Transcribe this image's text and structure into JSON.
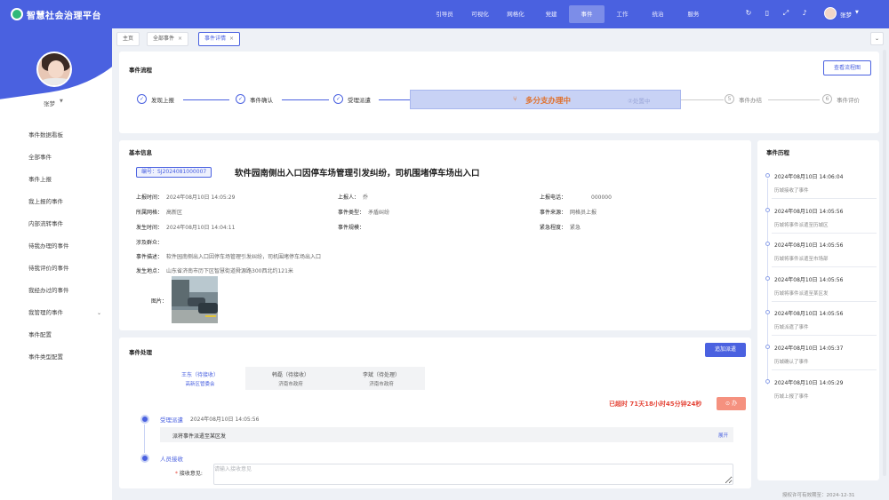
{
  "app": {
    "title": "智慧社会治理平台"
  },
  "nav": [
    "引导员",
    "可视化",
    "网格化",
    "党建",
    "事件",
    "工作",
    "统治",
    "服务"
  ],
  "nav_active_index": 4,
  "header": {
    "user": "张梦",
    "icons": [
      "refresh-icon",
      "mobile-icon",
      "fullscreen-icon",
      "bell-icon"
    ]
  },
  "sidebar": {
    "user": "张梦",
    "items": [
      "事件数据看板",
      "全部事件",
      "事件上报",
      "我上报的事件",
      "内部流转事件",
      "待我办理的事件",
      "待我评价的事件",
      "我经办过的事件",
      "我管理的事件",
      "事件配置",
      "事件类型配置"
    ]
  },
  "tabs": [
    {
      "label": "主页",
      "closable": false
    },
    {
      "label": "全部事件",
      "closable": true
    },
    {
      "label": "事件详情",
      "closable": true
    }
  ],
  "flow": {
    "title": "事件流程",
    "button": "查看流程图",
    "steps": [
      {
        "label": "发现上报",
        "state": "done"
      },
      {
        "label": "事件确认",
        "state": "done"
      },
      {
        "label": "受理派遣",
        "state": "done"
      },
      {
        "label": "事件办结",
        "state": "todo",
        "num": "5"
      },
      {
        "label": "事件评价",
        "state": "todo",
        "num": "6"
      }
    ],
    "current": {
      "label": "多分支办理中",
      "ghost": "②处置中"
    }
  },
  "basic": {
    "title": "基本信息",
    "code": "编号：SJ2024081000007",
    "event_title": "软件园南侧出入口因停车场管理引发纠纷，司机围堵停车场出入口",
    "fields": {
      "report_time_k": "上报时间：",
      "report_time_v": "2024年08月10日 14:05:29",
      "reporter_k": "上报人：",
      "reporter_v": "乔",
      "reporter_phone_k": "上报电话：",
      "reporter_phone_v": "000000",
      "grid_k": "所属网格：",
      "grid_v": "高新区",
      "type_k": "事件类型：",
      "type_v": "矛盾纠纷",
      "source_k": "事件来源：",
      "source_v": "网格员上报",
      "occur_k": "发生时间：",
      "occur_v": "2024年08月10日 14:04:11",
      "scale_k": "事件规模：",
      "scale_v": "",
      "urgency_k": "紧急程度：",
      "urgency_v": "紧急",
      "people_k": "涉及群众：",
      "people_v": "",
      "desc_k": "事件描述：",
      "desc_v": "软件园南侧出入口因停车场管理引发纠纷，司机围堵停车场出入口",
      "place_k": "发生地点：",
      "place_v": "山东省济南市历下区智慧街道舜源路300西北约121米",
      "photo_k": "图片："
    }
  },
  "history": {
    "title": "事件历程",
    "items": [
      {
        "time": "2024年08月10日 14:06:04",
        "desc": "历城接收了事件"
      },
      {
        "time": "2024年08月10日 14:05:56",
        "desc": "历城将事件派遣至历城区"
      },
      {
        "time": "2024年08月10日 14:05:56",
        "desc": "历城将事件派遣至市场部"
      },
      {
        "time": "2024年08月10日 14:05:56",
        "desc": "历城将事件派遣至某区发"
      },
      {
        "time": "2024年08月10日 14:05:56",
        "desc": "历城派遣了事件"
      },
      {
        "time": "2024年08月10日 14:05:37",
        "desc": "历城确认了事件"
      },
      {
        "time": "2024年08月10日 14:05:29",
        "desc": "历城上报了事件"
      }
    ]
  },
  "handling": {
    "title": "事件处理",
    "add_button": "追加派遣",
    "depts": [
      {
        "name": "王东（待接收）",
        "org": "高新区管委会"
      },
      {
        "name": "韩磊（待接收）",
        "org": "济南市政府"
      },
      {
        "name": "李斌（待处理）",
        "org": "济南市政府"
      }
    ],
    "overdue": "已超时 71天18小时45分钟24秒",
    "urge_button": "⊙ 办",
    "record": {
      "title": "受理派遣",
      "time": "2024年08月10日 14:05:56",
      "text": "派将事件派遣至某区发",
      "more": "展开"
    },
    "receive": {
      "title": "人员接收",
      "label": "接收意见:",
      "placeholder": "请输入接收意见"
    }
  },
  "footer": {
    "license": "授权许可有效期至：2024-12-31"
  }
}
